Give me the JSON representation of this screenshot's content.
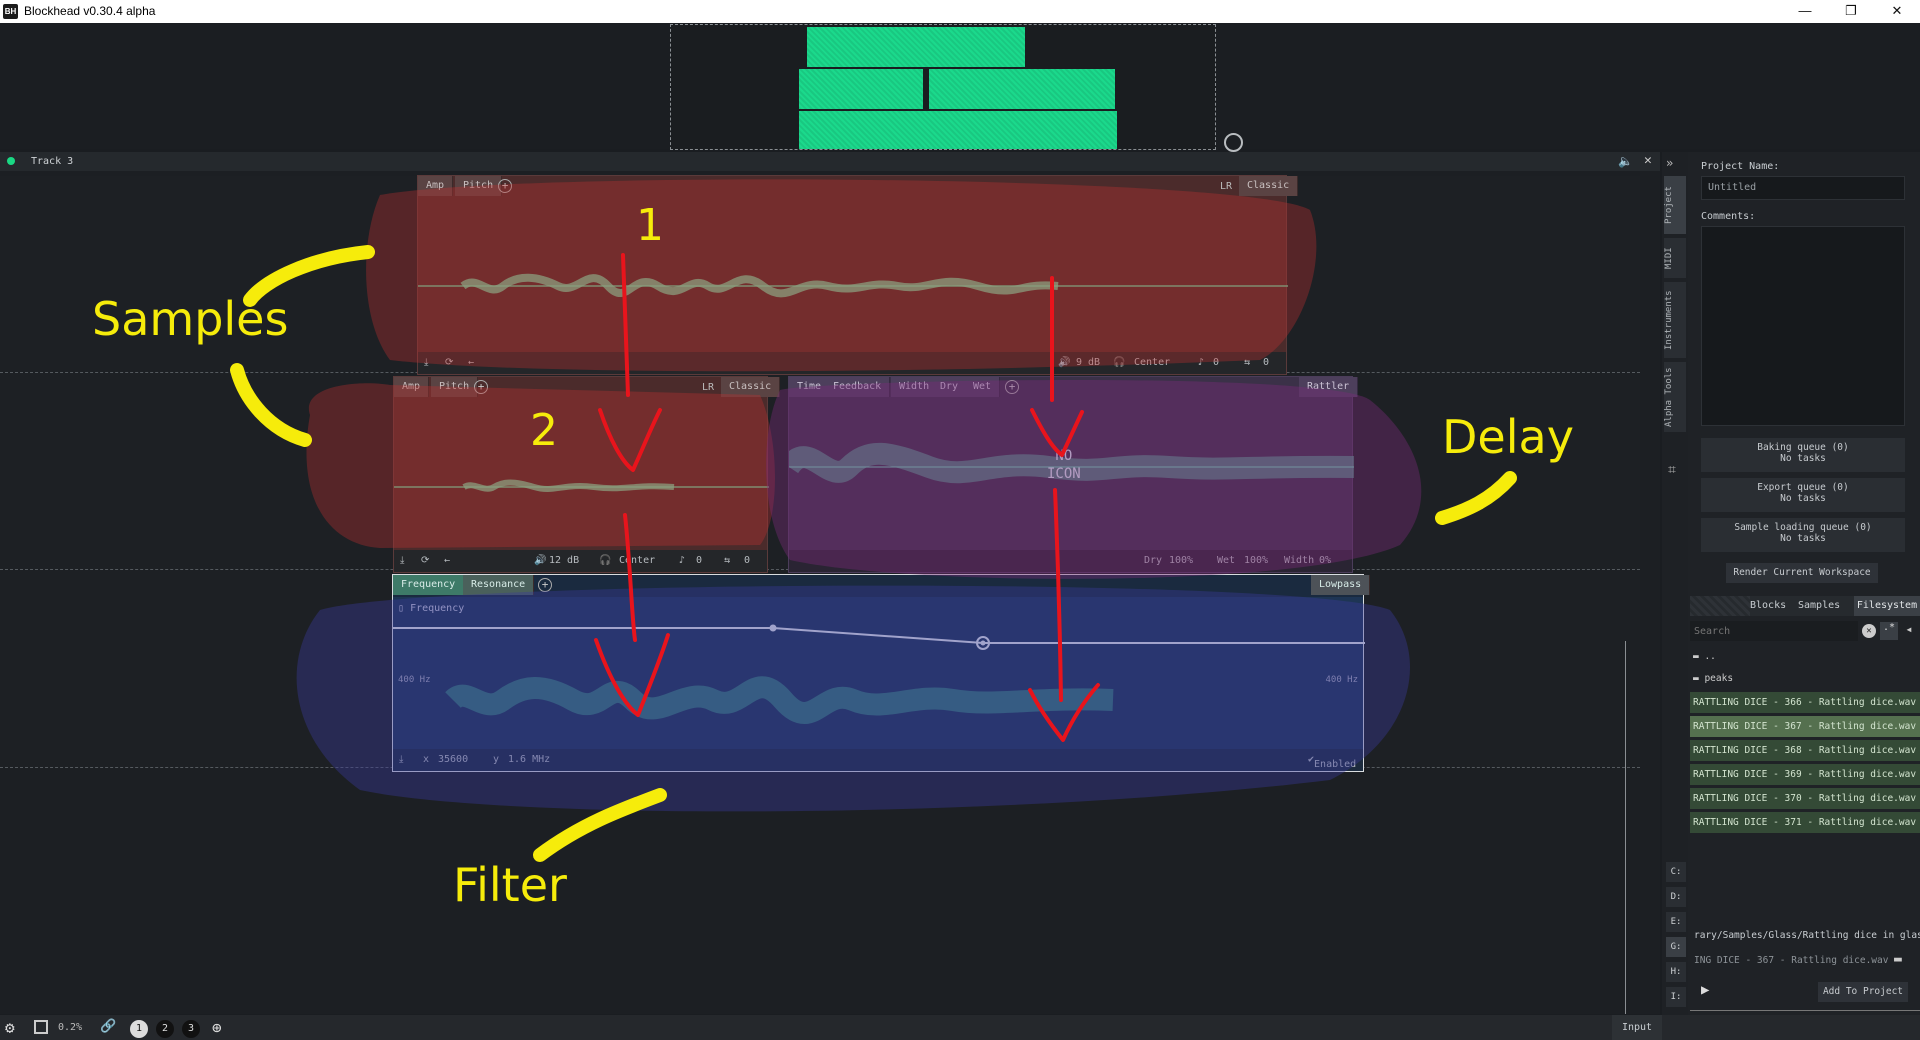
{
  "window": {
    "title": "Blockhead v0.30.4 alpha",
    "icon_label": "BH",
    "minimize": "—",
    "maximize": "❐",
    "close": "✕"
  },
  "track": {
    "name": "Track 3"
  },
  "blocks": {
    "sample1": {
      "tabs": [
        "Amp",
        "Pitch"
      ],
      "right_tabs": [
        "LR",
        "Classic"
      ],
      "amp": "9 dB",
      "pan": "Center",
      "pitch": "0",
      "offset": "0"
    },
    "sample2": {
      "tabs": [
        "Amp",
        "Pitch"
      ],
      "right_tabs": [
        "LR",
        "Classic"
      ],
      "amp": "12 dB",
      "pan": "Center",
      "pitch": "0",
      "offset": "0"
    },
    "delay": {
      "tabs": [
        "Time",
        "Feedback",
        "Width",
        "Dry",
        "Wet"
      ],
      "right_tab": "Rattler",
      "noicon_top": "NO",
      "noicon_bottom": "ICON",
      "dry_label": "Dry",
      "dry_value": "100%",
      "wet_label": "Wet",
      "wet_value": "100%",
      "width_label": "Width",
      "width_value": "0%"
    },
    "filter": {
      "tabs": [
        "Frequency",
        "Resonance"
      ],
      "right_tab": "Lowpass",
      "lane_label": "Frequency",
      "left_hz": "400 Hz",
      "right_hz": "400 Hz",
      "x_label": "x",
      "x_value": "35600",
      "y_label": "y",
      "y_value": "1.6 MHz",
      "enabled": "Enabled"
    }
  },
  "right_panel": {
    "vtabs": [
      "Project",
      "MIDI",
      "Instruments",
      "Alpha Tools"
    ],
    "project_name_label": "Project Name:",
    "project_name_value": "Untitled",
    "comments_label": "Comments:",
    "baking_queue": "Baking queue (0)",
    "export_queue": "Export queue (0)",
    "sample_loading_queue": "Sample loading queue (0)",
    "no_tasks": "No tasks",
    "render_button": "Render Current Workspace",
    "browser_tabs": [
      "Blocks",
      "Samples",
      "Filesystem"
    ],
    "search_placeholder": "Search",
    "folders": [
      "..",
      "peaks"
    ],
    "files": [
      "RATTLING DICE - 366 - Rattling dice.wav",
      "RATTLING DICE - 367 - Rattling dice.wav",
      "RATTLING DICE - 368 - Rattling dice.wav",
      "RATTLING DICE - 369 - Rattling dice.wav",
      "RATTLING DICE - 370 - Rattling dice.wav",
      "RATTLING DICE - 371 - Rattling dice.wav"
    ],
    "drives": [
      "C:",
      "D:",
      "E:",
      "G:",
      "H:",
      "I:"
    ],
    "path": "rary/Samples/Glass/Rattling dice in glass",
    "selected_file": "ING DICE - 367 - Rattling dice.wav",
    "add_to_project": "Add To Project"
  },
  "bottom_bar": {
    "cpu": "0.2%",
    "pages": [
      "1",
      "2",
      "3"
    ],
    "input_label": "Input"
  },
  "annotations": {
    "samples": "Samples",
    "delay": "Delay",
    "filter": "Filter",
    "one": "1",
    "two": "2"
  },
  "colors": {
    "accent_green": "#1bd98c",
    "sample_block": "#4b2b2b",
    "delay_block": "#3b3148",
    "filter_block": "#1e3554",
    "annotation_yellow": "#f6ec0b",
    "annotation_red": "#e8141c"
  }
}
